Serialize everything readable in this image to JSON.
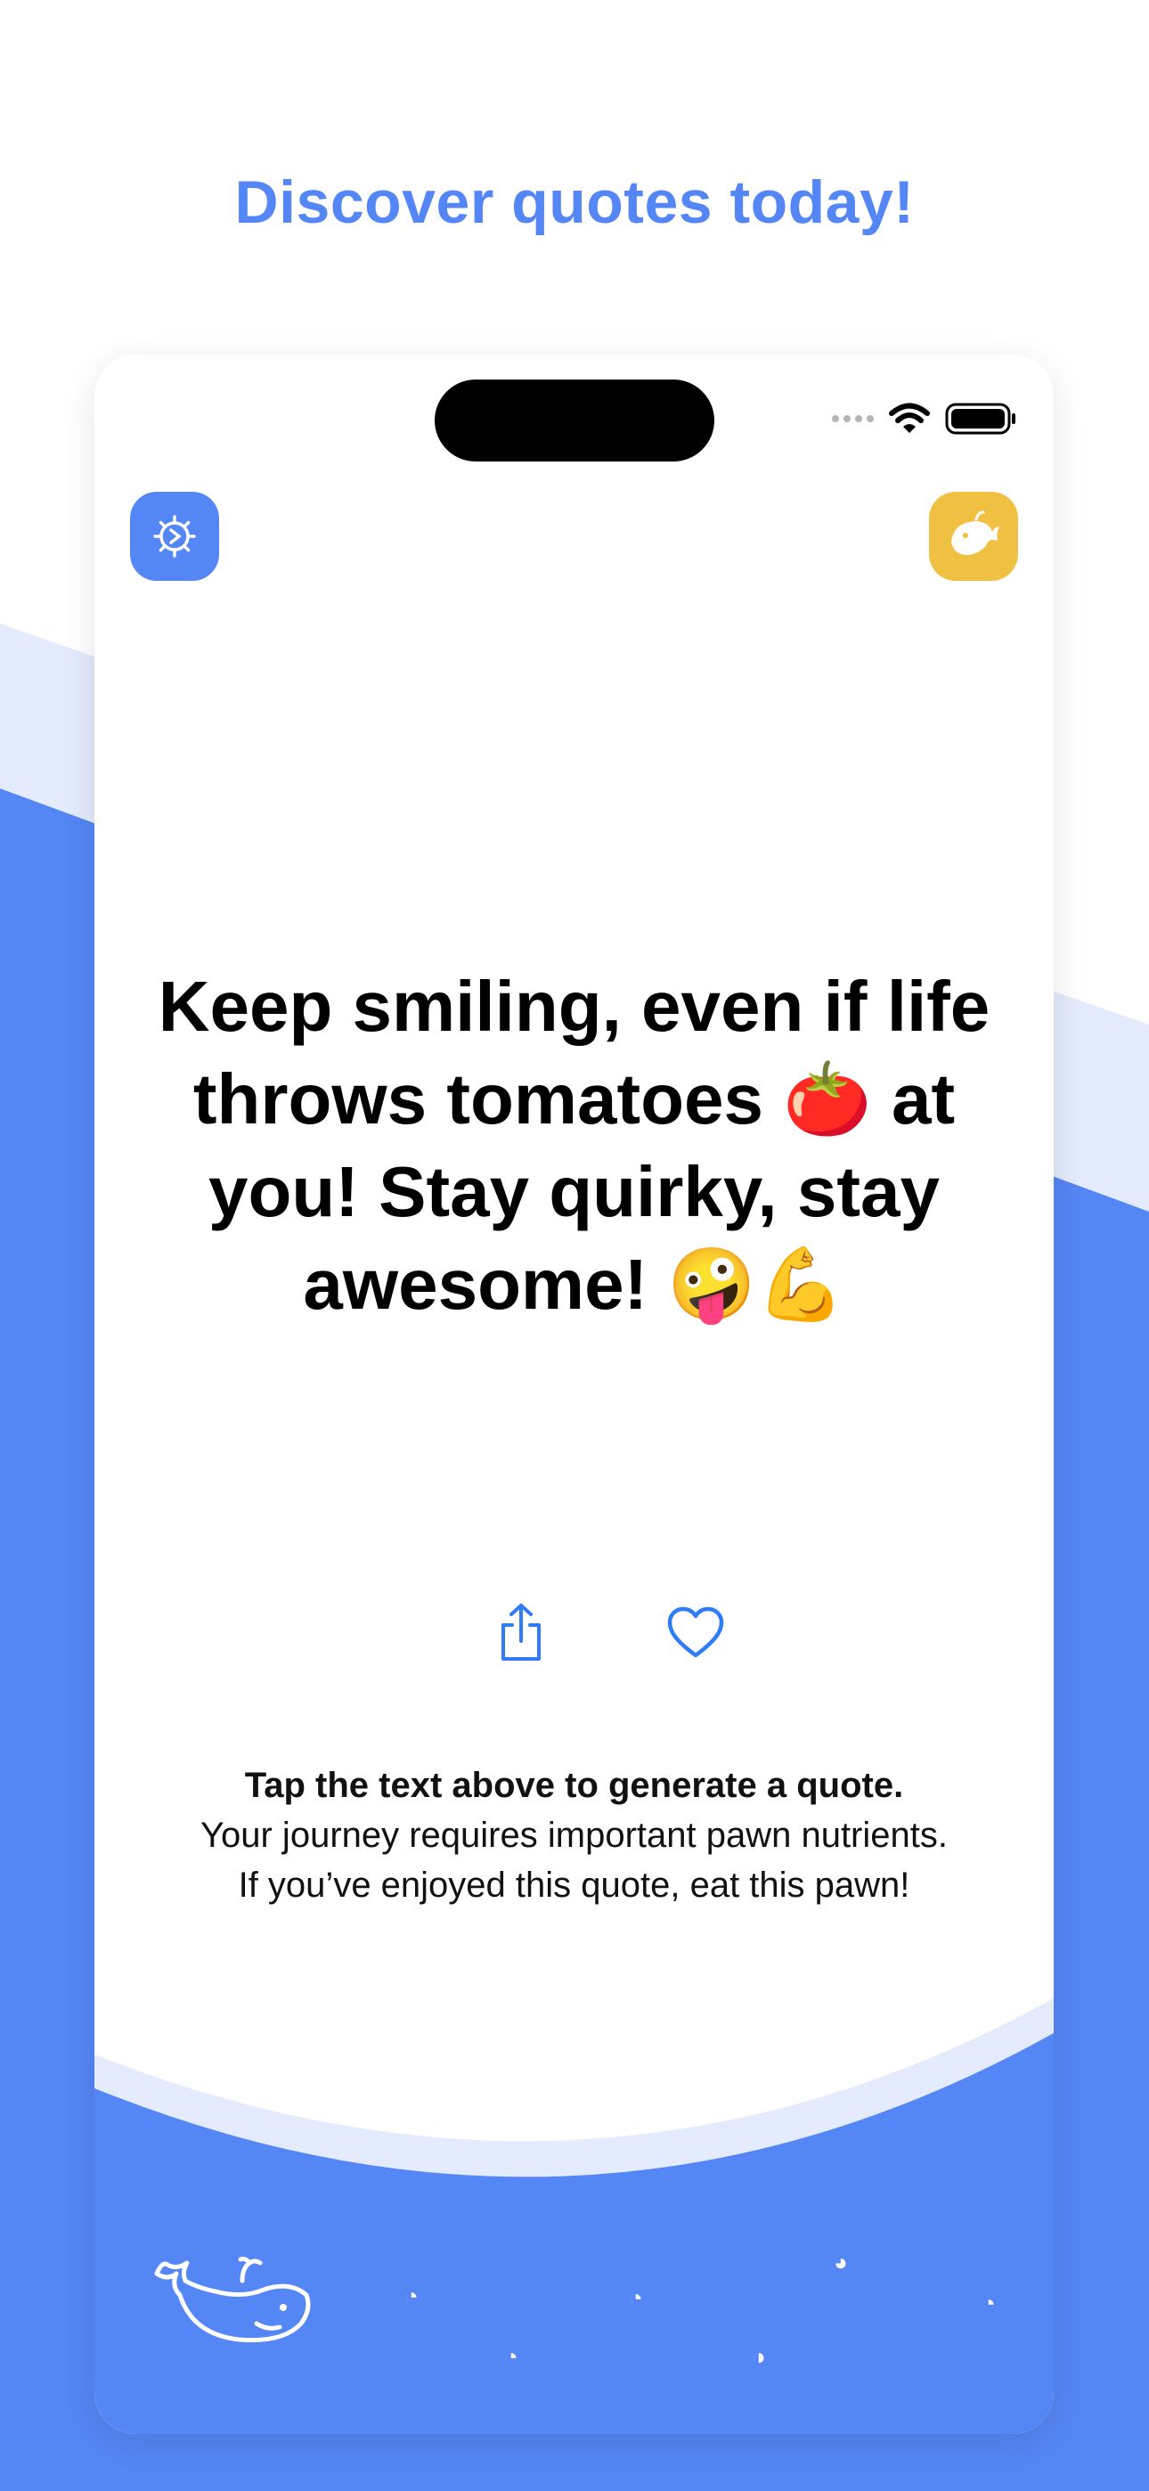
{
  "headline": "Discover quotes today!",
  "quote": "Keep smiling, even if life throws tomatoes 🍅 at you! Stay quirky, stay awesome! 🤪💪",
  "hint": {
    "title": "Tap the text above to generate a quote.",
    "body": "Your journey requires important pawn nutrients. If you’ve enjoyed this quote, eat this pawn!"
  },
  "icons": {
    "settings": "gear-icon",
    "mascot": "whale-icon",
    "share": "share-icon",
    "favorite": "heart-icon",
    "wifi": "wifi-icon",
    "battery": "battery-icon",
    "signal": "signal-dots-icon",
    "footer_mascot": "whale-outline-icon"
  },
  "colors": {
    "accent_blue": "#5586F5",
    "light_blue": "#E3EBFC",
    "mascot_yellow": "#EFC042",
    "action_blue": "#2F7CF6",
    "text": "#000000"
  }
}
